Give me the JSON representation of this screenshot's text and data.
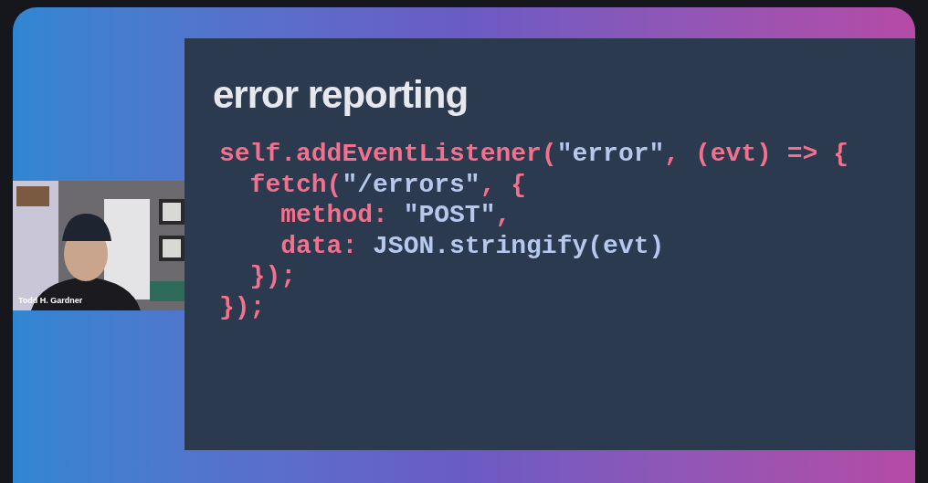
{
  "slide": {
    "title": "error reporting",
    "code_lines": [
      [
        {
          "kind": "plain",
          "text": "self.addEventListener("
        },
        {
          "kind": "string",
          "text": "\"error\""
        },
        {
          "kind": "plain",
          "text": ", (evt) => {"
        }
      ],
      [
        {
          "kind": "plain",
          "text": "  fetch("
        },
        {
          "kind": "string",
          "text": "\"/errors\""
        },
        {
          "kind": "plain",
          "text": ", {"
        }
      ],
      [
        {
          "kind": "plain",
          "text": "    method: "
        },
        {
          "kind": "string",
          "text": "\"POST\""
        },
        {
          "kind": "plain",
          "text": ","
        }
      ],
      [
        {
          "kind": "plain",
          "text": "    data: "
        },
        {
          "kind": "string",
          "text": "JSON.stringify(evt)"
        }
      ],
      [
        {
          "kind": "plain",
          "text": "  });"
        }
      ],
      [
        {
          "kind": "plain",
          "text": "});"
        }
      ]
    ]
  },
  "speaker": {
    "kind": "picture",
    "name": "Todd H. Gardner"
  }
}
